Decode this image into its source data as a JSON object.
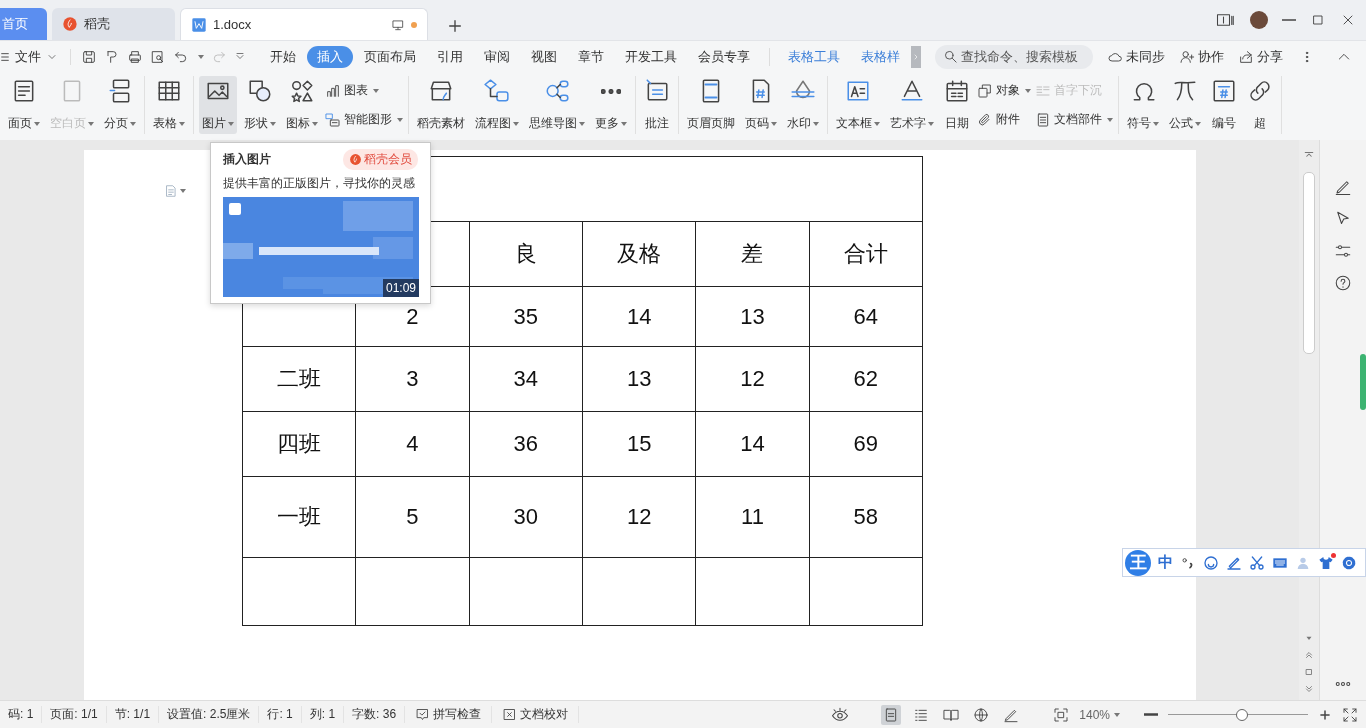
{
  "title_bar": {
    "tabs": [
      {
        "kind": "home",
        "label": "首页",
        "selected": false,
        "unsaved": false
      },
      {
        "kind": "app",
        "label": "稻壳",
        "selected": false,
        "unsaved": false
      },
      {
        "kind": "doc",
        "label": "1.docx",
        "selected": true,
        "unsaved": true
      }
    ]
  },
  "menu": {
    "file_label": "文件",
    "tabs": [
      {
        "kind": "main",
        "label": "开始",
        "selected": false
      },
      {
        "kind": "main",
        "label": "插入",
        "selected": true
      },
      {
        "kind": "main",
        "label": "页面布局",
        "selected": false
      },
      {
        "kind": "main",
        "label": "引用",
        "selected": false
      },
      {
        "kind": "main",
        "label": "审阅",
        "selected": false
      },
      {
        "kind": "main",
        "label": "视图",
        "selected": false
      },
      {
        "kind": "main",
        "label": "章节",
        "selected": false
      },
      {
        "kind": "main",
        "label": "开发工具",
        "selected": false
      },
      {
        "kind": "main",
        "label": "会员专享",
        "selected": false
      },
      {
        "kind": "context",
        "label": "表格工具",
        "selected": false
      },
      {
        "kind": "context",
        "label": "表格样",
        "selected": false
      }
    ],
    "search": {
      "placeholder": "查找命令、搜索模板"
    },
    "actions": [
      "未同步",
      "协作",
      "分享"
    ]
  },
  "ribbon": {
    "groups": [
      {
        "items": [
          {
            "kind": "big",
            "label": "面页",
            "dropdown": true,
            "disabled": false,
            "selected": false
          },
          {
            "kind": "big",
            "label": "空白页",
            "dropdown": true,
            "disabled": true,
            "selected": false
          },
          {
            "kind": "big",
            "label": "分页",
            "dropdown": true,
            "disabled": false,
            "selected": false
          }
        ]
      },
      {
        "items": [
          {
            "kind": "big",
            "label": "表格",
            "dropdown": true,
            "disabled": false,
            "selected": false
          }
        ]
      },
      {
        "items": [
          {
            "kind": "big",
            "label": "图片",
            "dropdown": true,
            "disabled": false,
            "selected": true
          },
          {
            "kind": "big",
            "label": "形状",
            "dropdown": true,
            "disabled": false,
            "selected": false
          },
          {
            "kind": "big",
            "label": "图标",
            "dropdown": true,
            "disabled": false,
            "selected": false
          },
          {
            "kind": "stack",
            "rows": [
              {
                "label": "图表",
                "dropdown": true,
                "disabled": false
              },
              {
                "label": "智能图形",
                "dropdown": true,
                "disabled": false
              }
            ]
          }
        ]
      },
      {
        "items": [
          {
            "kind": "big",
            "label": "稻壳素材",
            "dropdown": false,
            "disabled": false,
            "selected": false
          },
          {
            "kind": "big",
            "label": "流程图",
            "dropdown": true,
            "disabled": false,
            "selected": false
          },
          {
            "kind": "big",
            "label": "思维导图",
            "dropdown": true,
            "disabled": false,
            "selected": false
          },
          {
            "kind": "big",
            "label": "更多",
            "dropdown": true,
            "disabled": false,
            "selected": false
          }
        ]
      },
      {
        "items": [
          {
            "kind": "big",
            "label": "批注",
            "dropdown": false,
            "disabled": false,
            "selected": false
          }
        ]
      },
      {
        "items": [
          {
            "kind": "big",
            "label": "页眉页脚",
            "dropdown": false,
            "disabled": false,
            "selected": false
          },
          {
            "kind": "big",
            "label": "页码",
            "dropdown": true,
            "disabled": false,
            "selected": false
          },
          {
            "kind": "big",
            "label": "水印",
            "dropdown": true,
            "disabled": false,
            "selected": false
          }
        ]
      },
      {
        "items": [
          {
            "kind": "big",
            "label": "文本框",
            "dropdown": true,
            "disabled": false,
            "selected": false
          },
          {
            "kind": "big",
            "label": "艺术字",
            "dropdown": true,
            "disabled": false,
            "selected": false
          },
          {
            "kind": "big",
            "label": "日期",
            "dropdown": false,
            "disabled": false,
            "selected": false
          },
          {
            "kind": "stack",
            "rows": [
              {
                "label": "对象",
                "dropdown": true,
                "disabled": false
              },
              {
                "label": "附件",
                "dropdown": false,
                "disabled": false
              }
            ]
          },
          {
            "kind": "stack",
            "rows": [
              {
                "label": "首字下沉",
                "dropdown": false,
                "disabled": true
              },
              {
                "label": "文档部件",
                "dropdown": true,
                "disabled": false
              }
            ]
          }
        ]
      },
      {
        "items": [
          {
            "kind": "big",
            "label": "符号",
            "dropdown": true,
            "disabled": false,
            "selected": false
          },
          {
            "kind": "big",
            "label": "公式",
            "dropdown": true,
            "disabled": false,
            "selected": false
          },
          {
            "kind": "big",
            "label": "编号",
            "dropdown": false,
            "disabled": false,
            "selected": false
          },
          {
            "kind": "big",
            "label": "超",
            "dropdown": false,
            "disabled": false,
            "selected": false
          }
        ]
      }
    ]
  },
  "popup": {
    "title": "插入图片",
    "badge": "稻壳会员",
    "description": "提供丰富的正版图片，寻找你的灵感",
    "video": {
      "kind": "picture",
      "duration": "01:09"
    }
  },
  "table": {
    "rows": [
      {
        "kind": "merged"
      },
      {
        "kind": "normal",
        "cells": [
          null,
          null,
          "良",
          "及格",
          "差",
          "合计"
        ]
      },
      {
        "kind": "normal",
        "cells": [
          null,
          "2",
          "35",
          "14",
          "13",
          "64"
        ]
      },
      {
        "kind": "normal",
        "cells": [
          "二班",
          "3",
          "34",
          "13",
          "12",
          "62"
        ]
      },
      {
        "kind": "normal",
        "cells": [
          "四班",
          "4",
          "36",
          "15",
          "14",
          "69"
        ]
      },
      {
        "kind": "normal",
        "cells": [
          "一班",
          "5",
          "30",
          "12",
          "11",
          "58"
        ]
      },
      {
        "kind": "normal",
        "cells": [
          null,
          null,
          null,
          null,
          null,
          null
        ]
      }
    ]
  },
  "ime": {
    "logo": "王",
    "mode": "中"
  },
  "status_bar": {
    "fields": [
      "码: 1",
      "页面: 1/1",
      "节: 1/1",
      "设置值: 2.5厘米",
      "行: 1",
      "列: 1",
      "字数: 36"
    ],
    "checks": [
      "拼写检查",
      "文档校对"
    ],
    "views": [
      {
        "selected": true
      },
      {
        "selected": false
      },
      {
        "selected": false
      },
      {
        "selected": false
      },
      {
        "selected": false
      }
    ],
    "zoom": {
      "value": "140%",
      "level": 0.53
    }
  }
}
